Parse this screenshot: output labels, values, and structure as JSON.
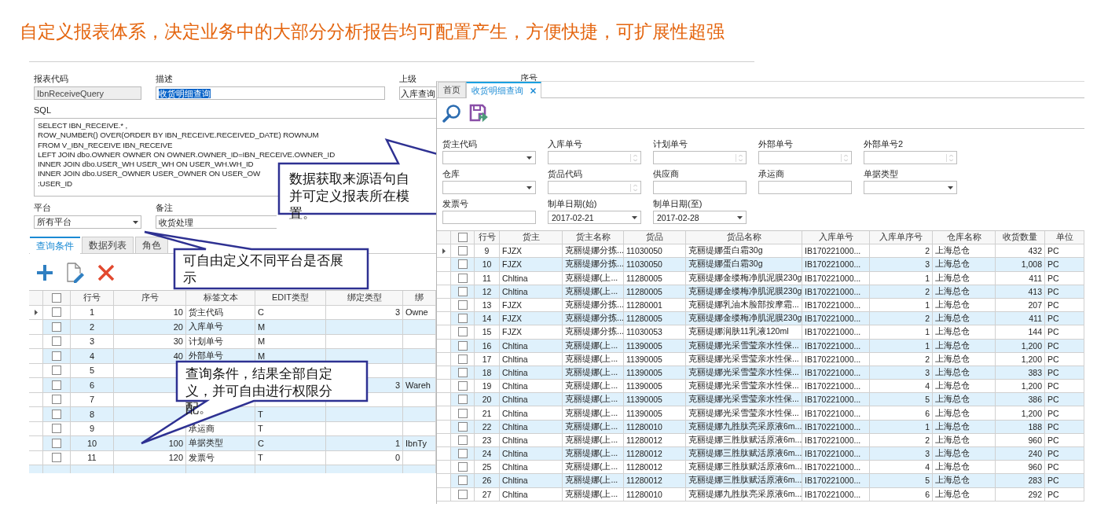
{
  "title": "自定义报表体系，决定业务中的大部分分析报告均可配置产生，方便快捷，可扩展性超强",
  "report_form": {
    "fields": [
      {
        "label": "报表代码",
        "value": "IbnReceiveQuery",
        "kind": "readonly"
      },
      {
        "label": "描述",
        "value": "收货明细查询",
        "kind": "highlighted"
      },
      {
        "label": "上级",
        "value": "入库查询",
        "kind": "text"
      }
    ],
    "extra_label": "序号",
    "sql_label": "SQL",
    "sql_lines": [
      "SELECT IBN_RECEIVE.* ,",
      "ROW_NUMBER() OVER(ORDER BY IBN_RECEIVE.RECEIVED_DATE) ROWNUM",
      "FROM V_IBN_RECEIVE IBN_RECEIVE",
      "LEFT JOIN dbo.OWNER OWNER ON OWNER.OWNER_ID=IBN_RECEIVE.OWNER_ID",
      "INNER JOIN dbo.USER_WH USER_WH ON USER_WH.WH_ID",
      "INNER JOIN dbo.USER_OWNER USER_OWNER ON USER_OW",
      ":USER_ID"
    ],
    "platform": {
      "label": "平台",
      "value": "所有平台"
    },
    "remark": {
      "label": "备注",
      "value": "收货处理"
    }
  },
  "left_tabs": [
    {
      "label": "查询条件",
      "selected": true
    },
    {
      "label": "数据列表",
      "selected": false
    },
    {
      "label": "角色",
      "selected": false
    }
  ],
  "condition_grid": {
    "all_checked": false,
    "columns": [
      "行号",
      "序号",
      "标签文本",
      "EDIT类型",
      "绑定类型",
      "绑"
    ],
    "rows": [
      {
        "current": true,
        "checked": false,
        "cells": [
          "1",
          "10",
          "货主代码",
          "C",
          "3",
          "Owne"
        ]
      },
      {
        "current": false,
        "checked": false,
        "cells": [
          "2",
          "20",
          "入库单号",
          "M",
          null,
          null
        ]
      },
      {
        "current": false,
        "checked": false,
        "cells": [
          "3",
          "30",
          "计划单号",
          "M",
          null,
          null
        ]
      },
      {
        "current": false,
        "checked": false,
        "cells": [
          "4",
          "40",
          "外部单号",
          "M",
          null,
          null
        ]
      },
      {
        "current": false,
        "checked": false,
        "cells": [
          "5",
          null,
          null,
          null,
          null,
          null
        ]
      },
      {
        "current": false,
        "checked": false,
        "cells": [
          "6",
          null,
          null,
          null,
          "3",
          "Wareh"
        ]
      },
      {
        "current": false,
        "checked": false,
        "cells": [
          "7",
          null,
          null,
          null,
          null,
          null
        ]
      },
      {
        "current": false,
        "checked": false,
        "cells": [
          "8",
          null,
          null,
          "T",
          null,
          null
        ]
      },
      {
        "current": false,
        "checked": false,
        "cells": [
          "9",
          null,
          "承运商",
          "T",
          null,
          null
        ]
      },
      {
        "current": false,
        "checked": false,
        "cells": [
          "10",
          "100",
          "单据类型",
          "C",
          "1",
          "IbnTy"
        ]
      },
      {
        "current": false,
        "checked": false,
        "cells": [
          "11",
          "120",
          "发票号",
          "T",
          "0",
          null
        ]
      }
    ]
  },
  "query_window": {
    "tabs": [
      {
        "label": "首页",
        "selected": false,
        "closable": false
      },
      {
        "label": "收货明细查询",
        "selected": true,
        "closable": true
      }
    ],
    "filters": [
      {
        "label": "货主代码",
        "kind": "combo"
      },
      {
        "label": "入库单号",
        "kind": "spin"
      },
      {
        "label": "计划单号",
        "kind": "spin"
      },
      {
        "label": "外部单号",
        "kind": "spin"
      },
      {
        "label": "外部单号2",
        "kind": "spin"
      },
      {
        "label": "仓库",
        "kind": "combo"
      },
      {
        "label": "货品代码",
        "kind": "spin"
      },
      {
        "label": "供应商",
        "kind": "text"
      },
      {
        "label": "承运商",
        "kind": "text"
      },
      {
        "label": "单据类型",
        "kind": "combo"
      },
      {
        "label": "发票号",
        "kind": "text"
      },
      {
        "label": "制单日期(始)",
        "kind": "combo",
        "value": "2017-02-21"
      },
      {
        "label": "制单日期(至)",
        "kind": "combo",
        "value": "2017-02-28"
      }
    ],
    "grid": {
      "all_checked": false,
      "columns": [
        "行号",
        "货主",
        "货主名称",
        "货品",
        "货品名称",
        "入库单号",
        "入库单序号",
        "仓库名称",
        "收货数量",
        "单位"
      ],
      "rows": [
        {
          "current": true,
          "checked": false,
          "cells": [
            "9",
            "FJZX",
            "克丽缇娜分拣...",
            "11030050",
            "克丽缇娜蛋白霜30g",
            "IB170221000...",
            "2",
            "上海总仓",
            "432",
            "PC"
          ]
        },
        {
          "current": false,
          "checked": false,
          "cells": [
            "10",
            "FJZX",
            "克丽缇娜分拣...",
            "11030050",
            "克丽缇娜蛋白霜30g",
            "IB170221000...",
            "3",
            "上海总仓",
            "1,008",
            "PC"
          ]
        },
        {
          "current": false,
          "checked": false,
          "cells": [
            "11",
            "Chltina",
            "克丽缇娜(上...",
            "11280005",
            "克丽缇娜金缕梅净肌泥膜230g",
            "IB170221000...",
            "1",
            "上海总仓",
            "411",
            "PC"
          ]
        },
        {
          "current": false,
          "checked": false,
          "cells": [
            "12",
            "Chltina",
            "克丽缇娜(上...",
            "11280005",
            "克丽缇娜金缕梅净肌泥膜230g",
            "IB170221000...",
            "2",
            "上海总仓",
            "413",
            "PC"
          ]
        },
        {
          "current": false,
          "checked": false,
          "cells": [
            "13",
            "FJZX",
            "克丽缇娜分拣...",
            "11280001",
            "克丽缇娜乳油木脸部按摩霜...",
            "IB170221000...",
            "1",
            "上海总仓",
            "207",
            "PC"
          ]
        },
        {
          "current": false,
          "checked": false,
          "cells": [
            "14",
            "FJZX",
            "克丽缇娜分拣...",
            "11280005",
            "克丽缇娜金缕梅净肌泥膜230g",
            "IB170221000...",
            "2",
            "上海总仓",
            "411",
            "PC"
          ]
        },
        {
          "current": false,
          "checked": false,
          "cells": [
            "15",
            "FJZX",
            "克丽缇娜分拣...",
            "11030053",
            "克丽缇娜润肤11乳液120ml",
            "IB170221000...",
            "1",
            "上海总仓",
            "144",
            "PC"
          ]
        },
        {
          "current": false,
          "checked": false,
          "cells": [
            "16",
            "Chltina",
            "克丽缇娜(上...",
            "11390005",
            "克丽缇娜光采雪莹亲水性保...",
            "IB170221000...",
            "1",
            "上海总仓",
            "1,200",
            "PC"
          ]
        },
        {
          "current": false,
          "checked": false,
          "cells": [
            "17",
            "Chltina",
            "克丽缇娜(上...",
            "11390005",
            "克丽缇娜光采雪莹亲水性保...",
            "IB170221000...",
            "2",
            "上海总仓",
            "1,200",
            "PC"
          ]
        },
        {
          "current": false,
          "checked": false,
          "cells": [
            "18",
            "Chltina",
            "克丽缇娜(上...",
            "11390005",
            "克丽缇娜光采雪莹亲水性保...",
            "IB170221000...",
            "3",
            "上海总仓",
            "383",
            "PC"
          ]
        },
        {
          "current": false,
          "checked": false,
          "cells": [
            "19",
            "Chltina",
            "克丽缇娜(上...",
            "11390005",
            "克丽缇娜光采雪莹亲水性保...",
            "IB170221000...",
            "4",
            "上海总仓",
            "1,200",
            "PC"
          ]
        },
        {
          "current": false,
          "checked": false,
          "cells": [
            "20",
            "Chltina",
            "克丽缇娜(上...",
            "11390005",
            "克丽缇娜光采雪莹亲水性保...",
            "IB170221000...",
            "5",
            "上海总仓",
            "386",
            "PC"
          ]
        },
        {
          "current": false,
          "checked": false,
          "cells": [
            "21",
            "Chltina",
            "克丽缇娜(上...",
            "11390005",
            "克丽缇娜光采雪莹亲水性保...",
            "IB170221000...",
            "6",
            "上海总仓",
            "1,200",
            "PC"
          ]
        },
        {
          "current": false,
          "checked": false,
          "cells": [
            "22",
            "Chltina",
            "克丽缇娜(上...",
            "11280010",
            "克丽缇娜九胜肽亮采原液6m...",
            "IB170221000...",
            "1",
            "上海总仓",
            "188",
            "PC"
          ]
        },
        {
          "current": false,
          "checked": false,
          "cells": [
            "23",
            "Chltina",
            "克丽缇娜(上...",
            "11280012",
            "克丽缇娜三胜肽赋活原液6m...",
            "IB170221000...",
            "2",
            "上海总仓",
            "960",
            "PC"
          ]
        },
        {
          "current": false,
          "checked": false,
          "cells": [
            "24",
            "Chltina",
            "克丽缇娜(上...",
            "11280012",
            "克丽缇娜三胜肽赋活原液6m...",
            "IB170221000...",
            "3",
            "上海总仓",
            "240",
            "PC"
          ]
        },
        {
          "current": false,
          "checked": false,
          "cells": [
            "25",
            "Chltina",
            "克丽缇娜(上...",
            "11280012",
            "克丽缇娜三胜肽赋活原液6m...",
            "IB170221000...",
            "4",
            "上海总仓",
            "960",
            "PC"
          ]
        },
        {
          "current": false,
          "checked": false,
          "cells": [
            "26",
            "Chltina",
            "克丽缇娜(上...",
            "11280012",
            "克丽缇娜三胜肽赋活原液6m...",
            "IB170221000...",
            "5",
            "上海总仓",
            "283",
            "PC"
          ]
        },
        {
          "current": false,
          "checked": false,
          "cells": [
            "27",
            "Chltina",
            "克丽缇娜(上...",
            "11280010",
            "克丽缇娜九胜肽亮采原液6m...",
            "IB170221000...",
            "6",
            "上海总仓",
            "292",
            "PC"
          ]
        }
      ]
    }
  },
  "callouts": [
    {
      "lines": [
        "数据获取来源语句自",
        "并可定义报表所在模",
        "置。"
      ]
    },
    {
      "lines": [
        "可自由定义不同平台是否展",
        "示"
      ]
    },
    {
      "lines": [
        "查询条件，结果全部自定",
        "义，并可自由进行权限分",
        "配。"
      ]
    }
  ]
}
